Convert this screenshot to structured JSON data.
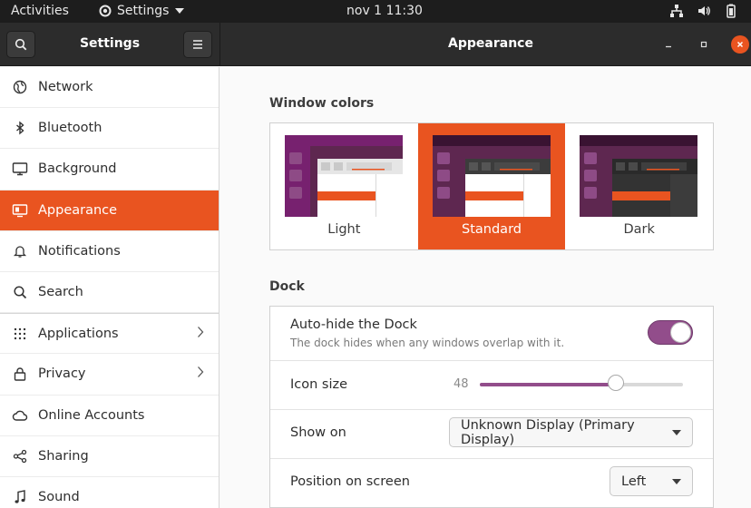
{
  "topbar": {
    "activities": "Activities",
    "app_menu": "Settings",
    "clock": "nov 1  11:30",
    "icons": [
      "network-icon",
      "volume-icon",
      "battery-icon"
    ]
  },
  "header": {
    "sidebar_title": "Settings",
    "panel_title": "Appearance",
    "buttons": [
      "search-icon",
      "hamburger-menu-icon",
      "minimize-icon",
      "maximize-icon",
      "close-icon"
    ]
  },
  "sidebar": {
    "items": [
      {
        "label": "Network",
        "icon": "network-globe-icon",
        "active": false,
        "chevron": false
      },
      {
        "label": "Bluetooth",
        "icon": "bluetooth-icon",
        "active": false,
        "chevron": false
      },
      {
        "label": "Background",
        "icon": "monitor-icon",
        "active": false,
        "chevron": false
      },
      {
        "label": "Appearance",
        "icon": "appearance-icon",
        "active": true,
        "chevron": false
      },
      {
        "label": "Notifications",
        "icon": "bell-icon",
        "active": false,
        "chevron": false
      },
      {
        "label": "Search",
        "icon": "search-icon",
        "active": false,
        "chevron": false
      },
      {
        "label": "Applications",
        "icon": "apps-grid-icon",
        "active": false,
        "chevron": true
      },
      {
        "label": "Privacy",
        "icon": "lock-icon",
        "active": false,
        "chevron": true
      },
      {
        "label": "Online Accounts",
        "icon": "cloud-icon",
        "active": false,
        "chevron": false
      },
      {
        "label": "Sharing",
        "icon": "share-icon",
        "active": false,
        "chevron": false
      },
      {
        "label": "Sound",
        "icon": "music-note-icon",
        "active": false,
        "chevron": false
      }
    ]
  },
  "window_colors": {
    "title": "Window colors",
    "options": [
      {
        "label": "Light",
        "selected": false
      },
      {
        "label": "Standard",
        "selected": true
      },
      {
        "label": "Dark",
        "selected": false
      }
    ]
  },
  "dock": {
    "title": "Dock",
    "autohide": {
      "label": "Auto-hide the Dock",
      "description": "The dock hides when any windows overlap with it.",
      "enabled": true
    },
    "icon_size": {
      "label": "Icon size",
      "value": "48",
      "fraction": 0.67
    },
    "show_on": {
      "label": "Show on",
      "value": "Unknown Display (Primary Display)"
    },
    "position": {
      "label": "Position on screen",
      "value": "Left"
    }
  },
  "colors": {
    "accent": "#e95420",
    "aubergine": "#77216f",
    "toggle": "#924d8b",
    "header": "#2c2c2c",
    "topbar": "#1d1d1d"
  }
}
